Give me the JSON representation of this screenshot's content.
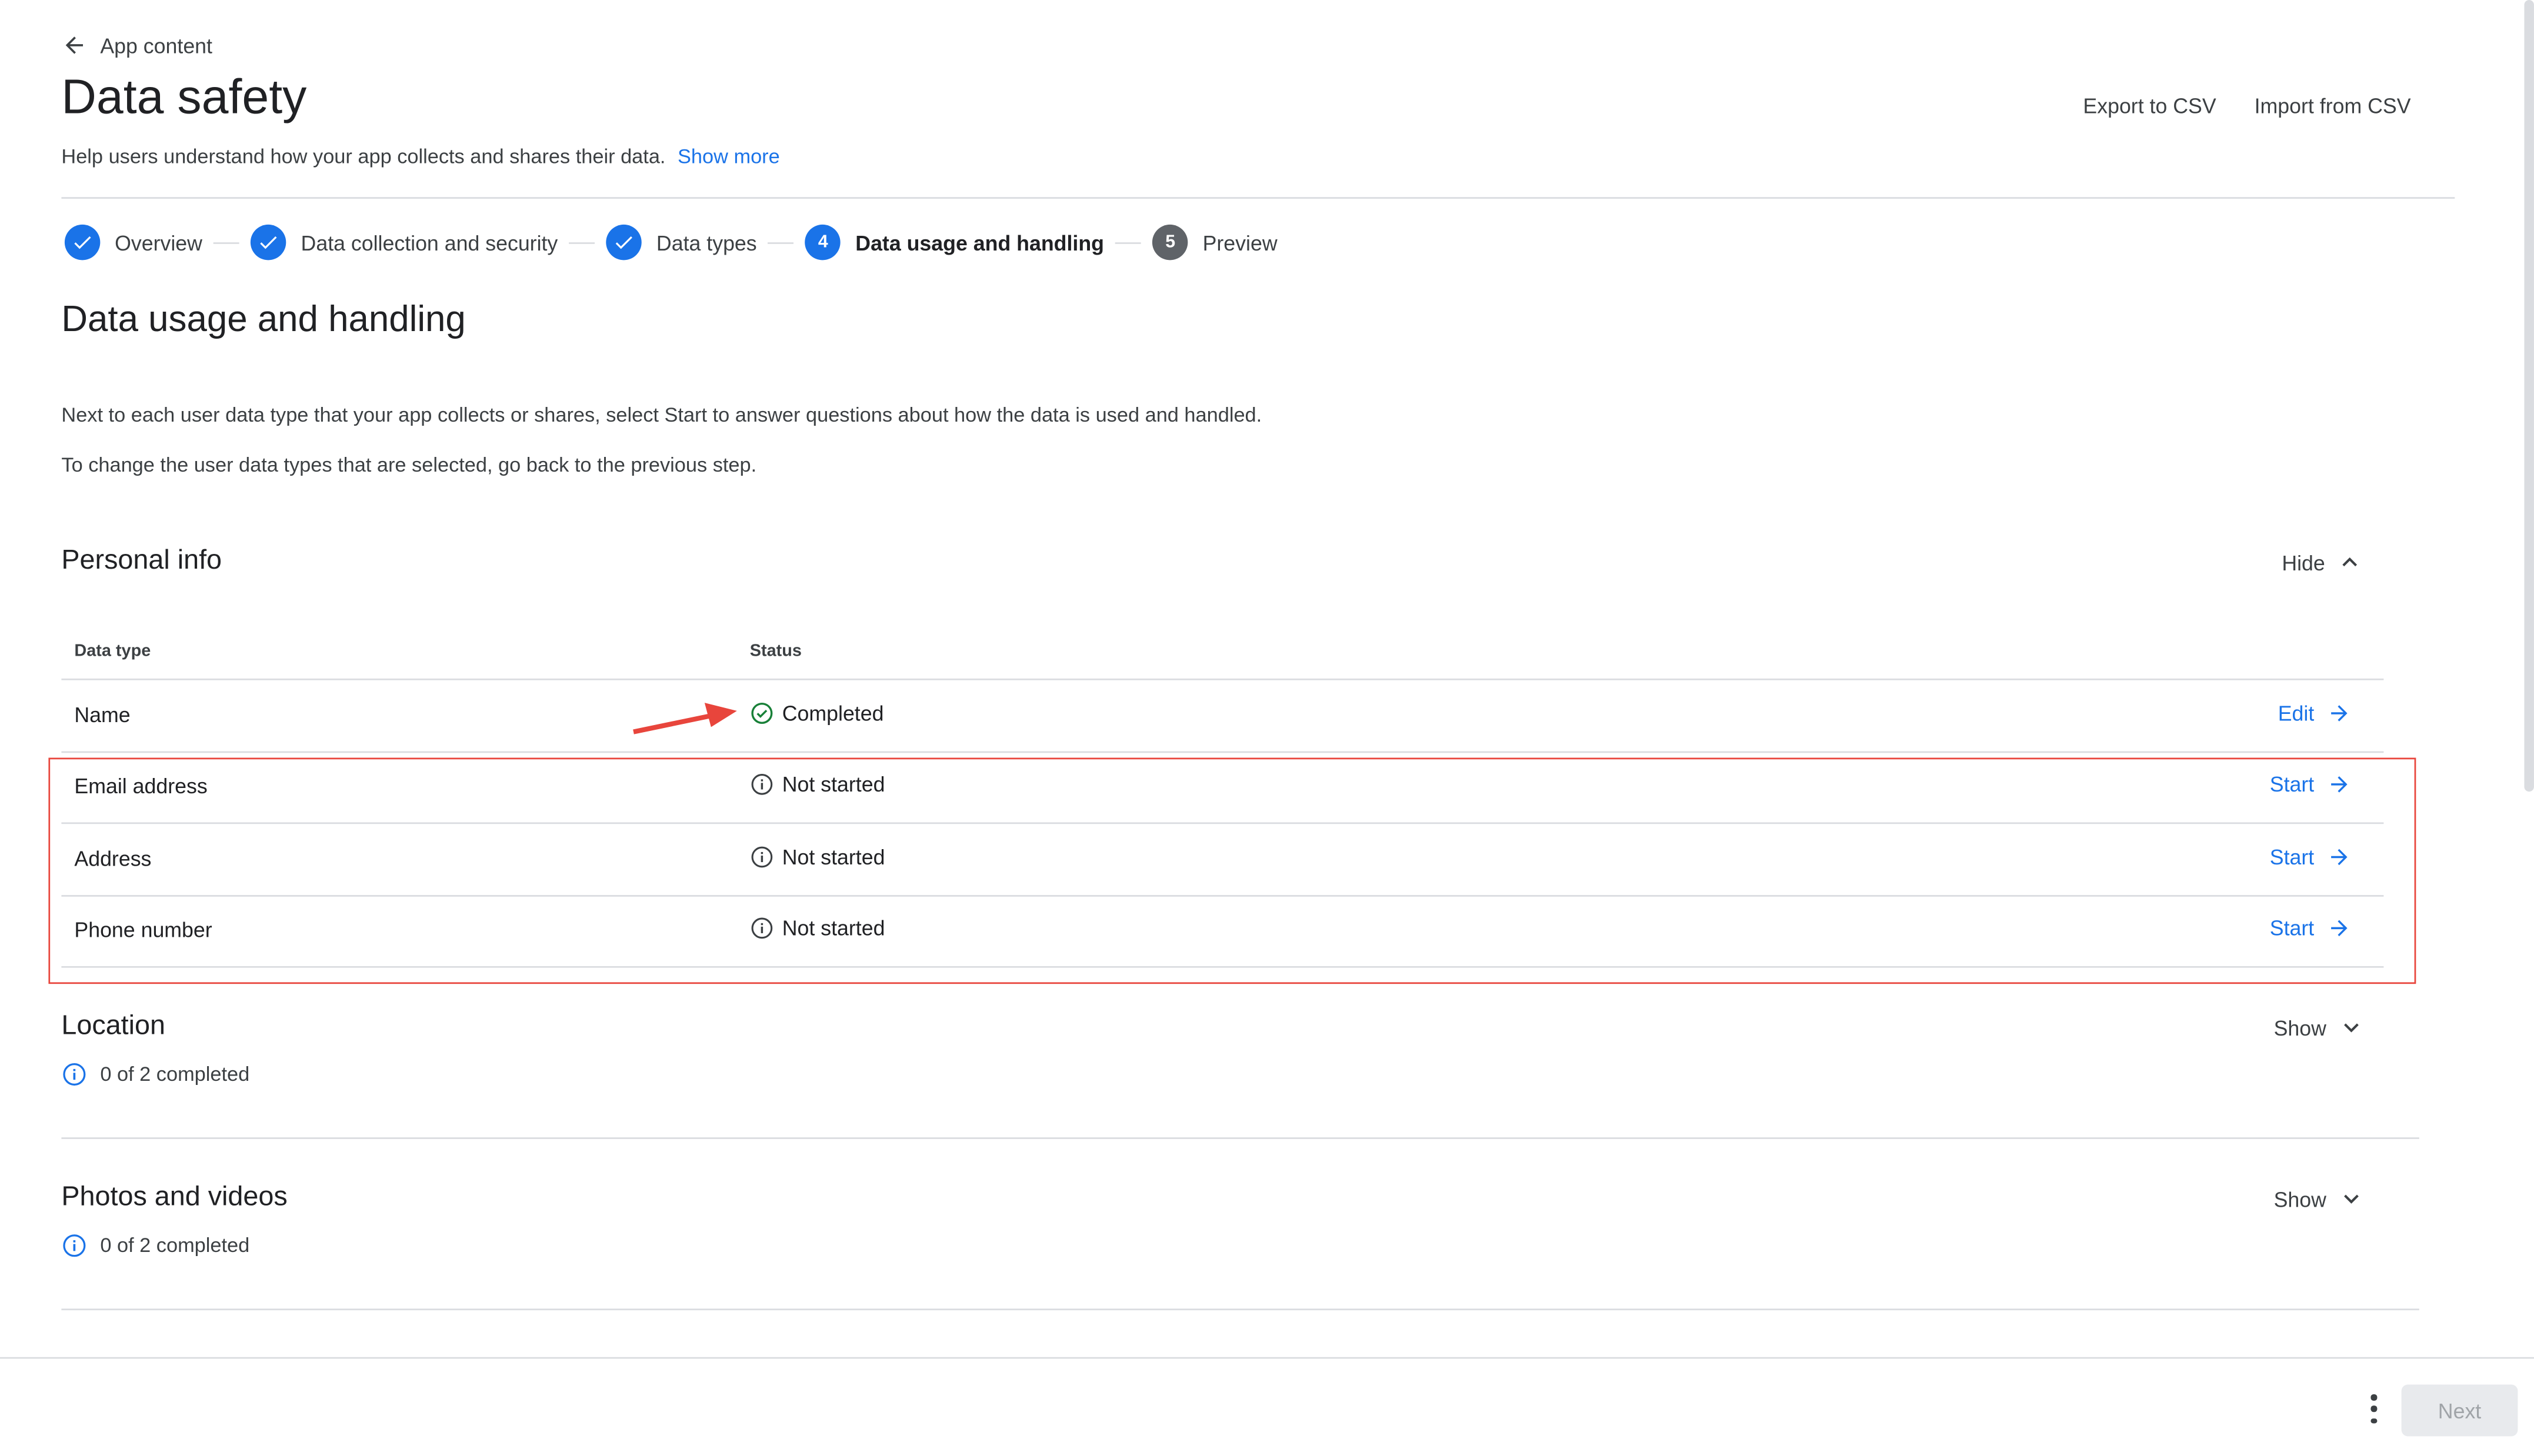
{
  "header": {
    "back_label": "App content",
    "title": "Data safety",
    "subtitle": "Help users understand how your app collects and shares their data.",
    "show_more": "Show more",
    "export_csv": "Export to CSV",
    "import_csv": "Import from CSV"
  },
  "stepper": {
    "steps": [
      {
        "label": "Overview",
        "state": "done"
      },
      {
        "label": "Data collection and security",
        "state": "done"
      },
      {
        "label": "Data types",
        "state": "done"
      },
      {
        "label": "Data usage and handling",
        "state": "active",
        "number": "4"
      },
      {
        "label": "Preview",
        "state": "todo",
        "number": "5"
      }
    ]
  },
  "main": {
    "heading": "Data usage and handling",
    "para1": "Next to each user data type that your app collects or shares, select Start to answer questions about how the data is used and handled.",
    "para2": "To change the user data types that are selected, go back to the previous step."
  },
  "personal_info": {
    "title": "Personal info",
    "toggle": "Hide",
    "col_type": "Data type",
    "col_status": "Status",
    "rows": [
      {
        "type": "Name",
        "status": "Completed",
        "action": "Edit",
        "status_kind": "completed"
      },
      {
        "type": "Email address",
        "status": "Not started",
        "action": "Start",
        "status_kind": "not-started"
      },
      {
        "type": "Address",
        "status": "Not started",
        "action": "Start",
        "status_kind": "not-started"
      },
      {
        "type": "Phone number",
        "status": "Not started",
        "action": "Start",
        "status_kind": "not-started"
      }
    ]
  },
  "location": {
    "title": "Location",
    "toggle": "Show",
    "progress": "0 of 2 completed"
  },
  "photos": {
    "title": "Photos and videos",
    "toggle": "Show",
    "progress": "0 of 2 completed"
  },
  "footer": {
    "next_label": "Next"
  },
  "colors": {
    "accent": "#1a73e8",
    "success": "#188038",
    "annotation": "#e8453c",
    "text": "#202124"
  },
  "icons": {
    "back": "arrow-left-icon",
    "check": "check-icon",
    "completed": "check-circle-icon",
    "not_started": "info-icon",
    "action": "arrow-right-icon",
    "chevron_up": "chevron-up-icon",
    "chevron_down": "chevron-down-icon",
    "more": "more-vert-icon"
  }
}
